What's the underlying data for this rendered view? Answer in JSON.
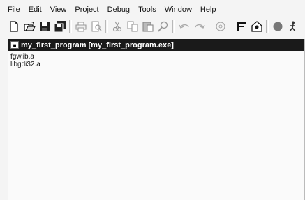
{
  "menu": {
    "file": {
      "u": "F",
      "rest": "ile"
    },
    "edit": {
      "u": "E",
      "rest": "dit"
    },
    "view": {
      "u": "V",
      "rest": "iew"
    },
    "project": {
      "u": "P",
      "rest": "roject"
    },
    "debug": {
      "u": "D",
      "rest": "ebug"
    },
    "tools": {
      "u": "T",
      "rest": "ools"
    },
    "window": {
      "u": "W",
      "rest": "indow"
    },
    "help": {
      "u": "H",
      "rest": "elp"
    }
  },
  "project_window": {
    "title": "my_first_program [my_first_program.exe]",
    "files": [
      "fgwlib.a",
      "libgdi32.a"
    ]
  },
  "icons": {
    "toolbar": [
      "new-file-icon",
      "open-folder-icon",
      "save-icon",
      "save-all-icon",
      "print-icon",
      "print-preview-icon",
      "cut-icon",
      "copy-icon",
      "paste-icon",
      "find-icon",
      "undo-icon",
      "redo-icon",
      "settings-icon",
      "compile-icon",
      "build-icon",
      "run-icon",
      "debug-icon"
    ]
  }
}
